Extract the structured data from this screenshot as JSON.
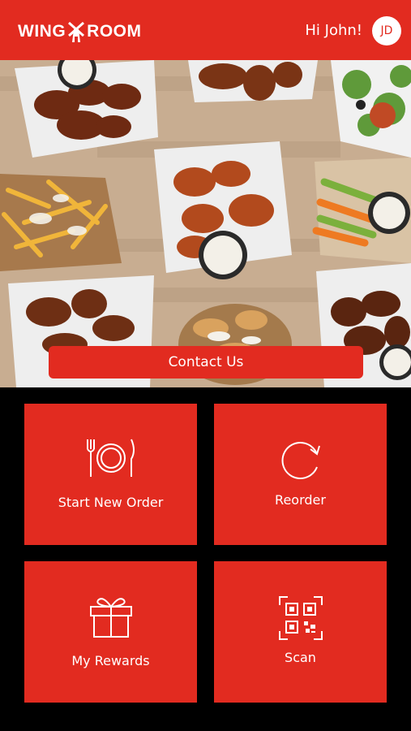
{
  "header": {
    "logo_left": "WING",
    "logo_right": "ROOM",
    "greeting": "Hi John!",
    "avatar_initials": "JD"
  },
  "hero": {
    "contact_label": "Contact Us"
  },
  "tiles": [
    {
      "label": "Start New Order",
      "icon": "plate-fork-knife-icon"
    },
    {
      "label": "Reorder",
      "icon": "reorder-refresh-icon"
    },
    {
      "label": "My Rewards",
      "icon": "gift-icon"
    },
    {
      "label": "Scan",
      "icon": "qr-scan-icon"
    }
  ],
  "colors": {
    "brand_red": "#e22b20",
    "background": "#000000"
  }
}
